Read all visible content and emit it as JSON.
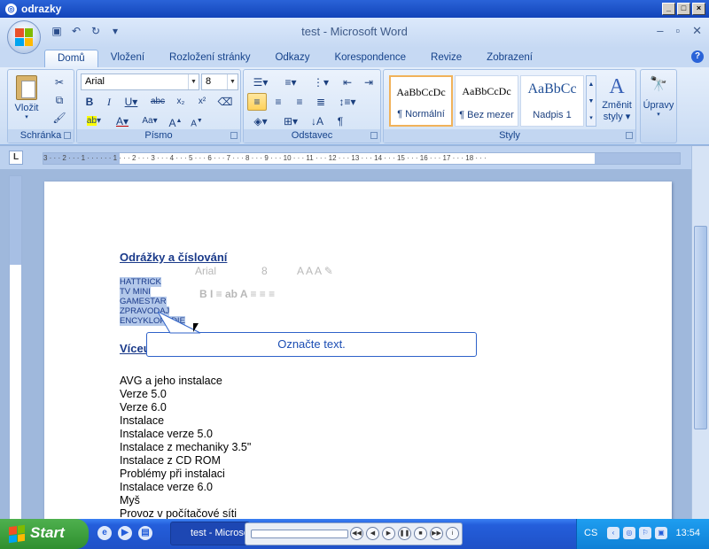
{
  "outer_window": {
    "title": "odrazky"
  },
  "word": {
    "title": "test - Microsoft Word",
    "tabs": [
      "Domů",
      "Vložení",
      "Rozložení stránky",
      "Odkazy",
      "Korespondence",
      "Revize",
      "Zobrazení"
    ],
    "active_tab": "Domů"
  },
  "ribbon": {
    "clipboard": {
      "label": "Schránka",
      "paste_label": "Vložit"
    },
    "font": {
      "label": "Písmo",
      "font_name": "Arial",
      "font_size": "8"
    },
    "paragraph": {
      "label": "Odstavec"
    },
    "styles": {
      "label": "Styly",
      "items": [
        {
          "sample": "AaBbCcDc",
          "name": "¶ Normální"
        },
        {
          "sample": "AaBbCcDc",
          "name": "¶ Bez mezer"
        },
        {
          "sample": "AaBbCc",
          "name": "Nadpis 1"
        }
      ],
      "change_label_1": "Změnit",
      "change_label_2": "styly"
    },
    "editing": {
      "label": "Úpravy"
    }
  },
  "document": {
    "heading1": "Odrážky a číslování",
    "selected_items": [
      "HATTRICK",
      "TV MINI",
      "GAMESTAR",
      "ZPRAVODAJ",
      "ENCYKLOPEDIE"
    ],
    "heading2": "Víceúrovňové číslování",
    "list_items": [
      "AVG a jeho instalace",
      "Verze 5.0",
      "Verze 6.0",
      "Instalace",
      "Instalace verze 5.0",
      "Instalace z mechaniky 3.5\"",
      "Instalace z CD ROM",
      "Problémy při instalaci",
      "Instalace verze 6.0",
      "Myš",
      "Provoz v počítačové síti"
    ]
  },
  "tooltip": {
    "text": "Označte text."
  },
  "minitoolbar": {
    "font": "Arial",
    "size": "8"
  },
  "taskbar": {
    "start_label": "Start",
    "word_task": "test - Microsoft Word",
    "language": "CS",
    "clock": "13:54"
  }
}
